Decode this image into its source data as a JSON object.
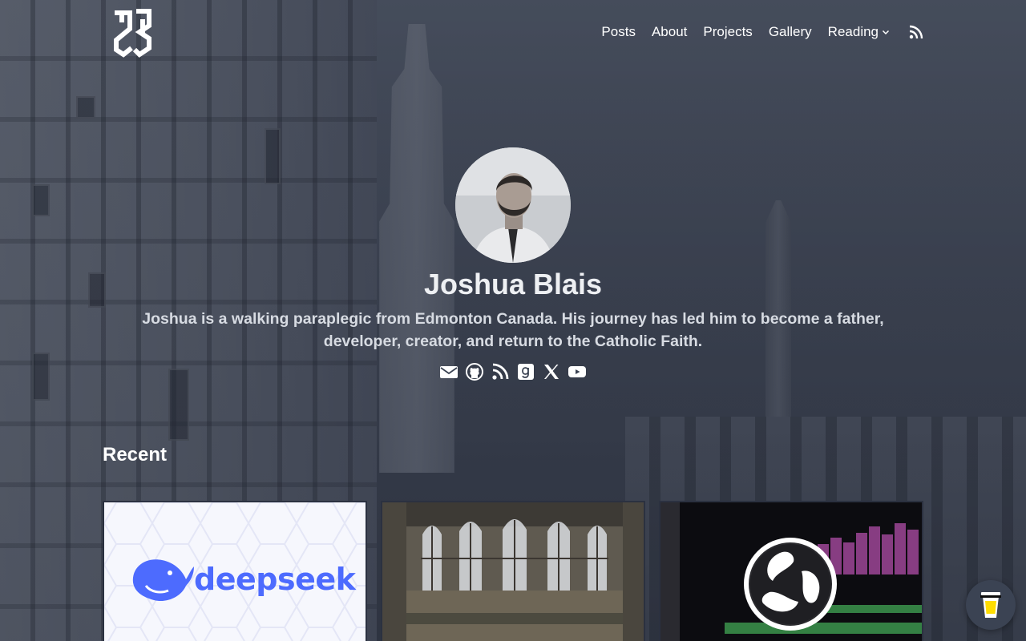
{
  "site": {
    "logo_icon": "jb-monogram-logo"
  },
  "nav": {
    "items": [
      {
        "label": "Posts"
      },
      {
        "label": "About"
      },
      {
        "label": "Projects"
      },
      {
        "label": "Gallery"
      },
      {
        "label": "Reading",
        "icon": "chevron-down-icon"
      }
    ],
    "rss_icon": "rss-icon"
  },
  "hero": {
    "name": "Joshua Blais",
    "bio": "Joshua is a walking paraplegic from Edmonton Canada. His journey has led him to become a father, developer, creator, and return to the Catholic Faith.",
    "avatar_icon": "profile-photo"
  },
  "socials": [
    {
      "icon": "envelope-icon"
    },
    {
      "icon": "github-icon"
    },
    {
      "icon": "rss-icon"
    },
    {
      "icon": "goodreads-icon"
    },
    {
      "icon": "x-icon"
    },
    {
      "icon": "youtube-icon"
    }
  ],
  "recent": {
    "title": "Recent",
    "cards": [
      {
        "image": "deepseek-thumbnail",
        "logo_text": "deepseek"
      },
      {
        "image": "cathedral-interior-thumbnail"
      },
      {
        "image": "obs-studio-thumbnail"
      }
    ]
  },
  "colors": {
    "text": "#ffffff",
    "deepseek_blue": "#4d6bfe",
    "overlay": "#3b4353"
  },
  "coffee_button": {
    "icon": "coffee-cup-icon"
  }
}
